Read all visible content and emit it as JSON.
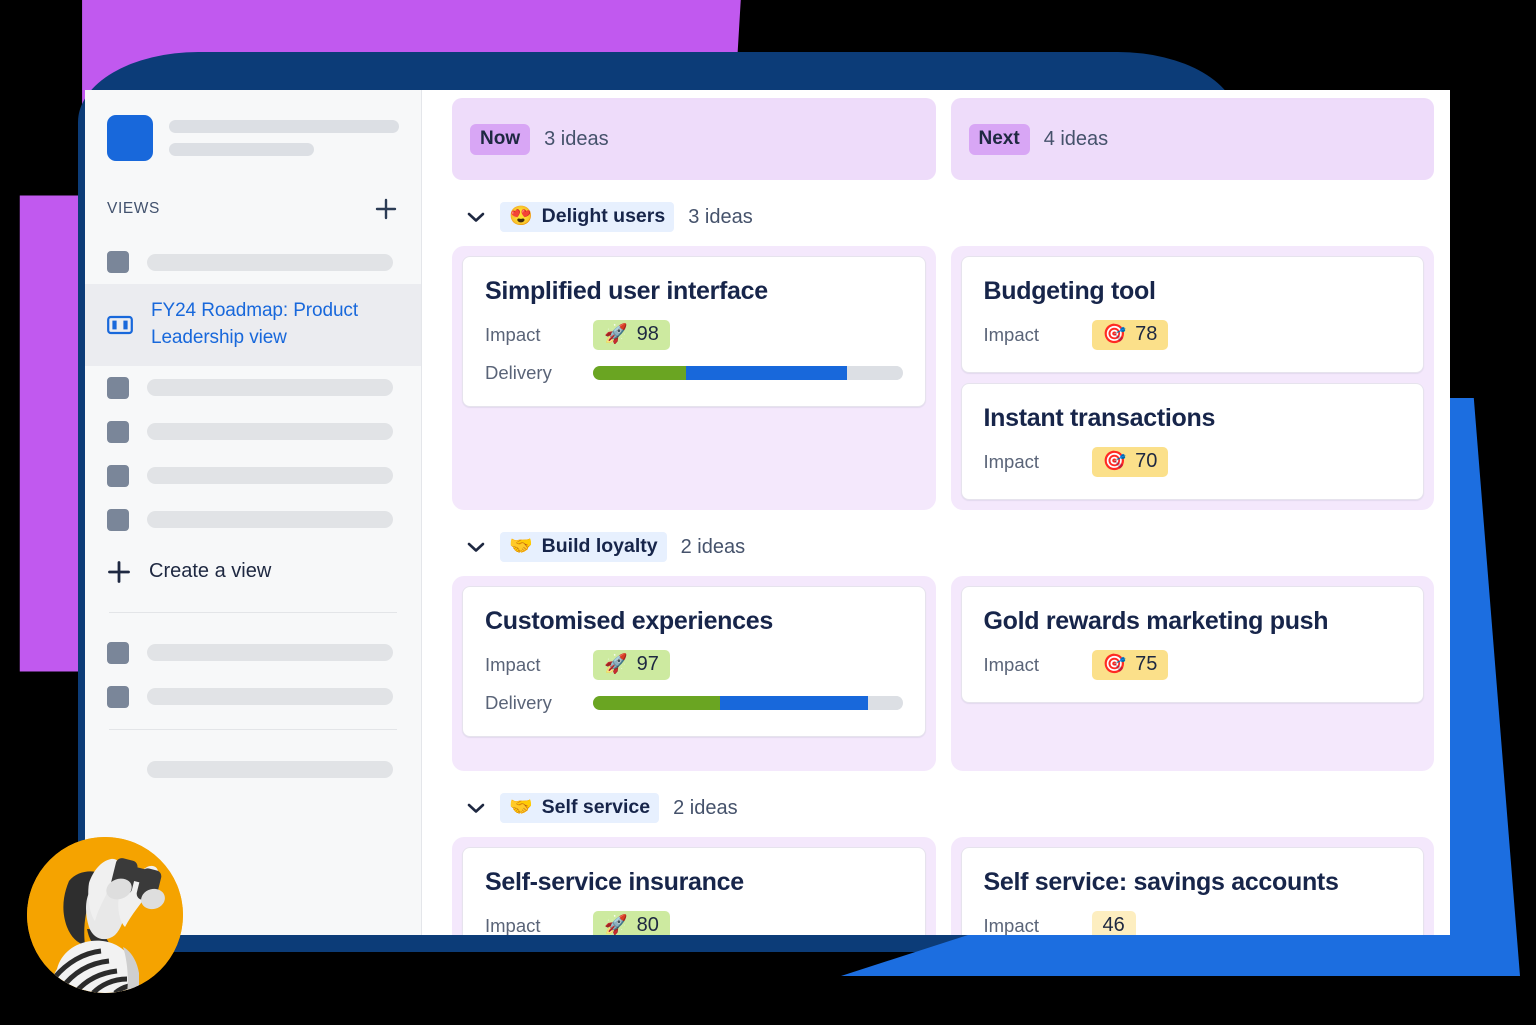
{
  "window": {
    "sidebar": {
      "views_heading": "VIEWS",
      "add_view_icon": "plus-icon",
      "active_view_label": "FY24 Roadmap: Product Leadership view",
      "active_view_icon": "board-columns-icon",
      "create_view_label": "Create a view",
      "create_view_icon": "plus-icon",
      "placeholder_items_top": 1,
      "placeholder_items_middle": 4,
      "placeholder_items_bottom": 2,
      "placeholder_items_footer": 1
    },
    "avatar": {
      "icon": "person-with-binoculars-photo",
      "background_color": "#f5a300"
    }
  },
  "board": {
    "columns": [
      {
        "pill": "Now",
        "count": "3 ideas"
      },
      {
        "pill": "Next",
        "count": "4 ideas"
      }
    ],
    "groups": [
      {
        "emoji": "😍",
        "emoji_name": "smiling-face-with-hearts-icon",
        "label": "Delight users",
        "count": "3 ideas",
        "chevron": "chevron-down-icon",
        "now_cards": [
          {
            "title": "Simplified user interface",
            "impact_label": "Impact",
            "impact_value": "98",
            "impact_emoji": "🚀",
            "impact_emoji_name": "rocket-icon",
            "impact_style": "green",
            "delivery_label": "Delivery",
            "delivery_segments": [
              {
                "color": "#6aa522",
                "percent": 30
              },
              {
                "color": "#1868db",
                "percent": 52
              },
              {
                "color": "#dcdfe4",
                "percent": 18
              }
            ]
          }
        ],
        "next_cards": [
          {
            "title": "Budgeting tool",
            "impact_label": "Impact",
            "impact_value": "78",
            "impact_emoji": "🎯",
            "impact_emoji_name": "target-icon",
            "impact_style": "yellow"
          },
          {
            "title": "Instant transactions",
            "impact_label": "Impact",
            "impact_value": "70",
            "impact_emoji": "🎯",
            "impact_emoji_name": "target-icon",
            "impact_style": "yellow"
          }
        ]
      },
      {
        "emoji": "🤝",
        "emoji_name": "handshake-icon",
        "label": "Build loyalty",
        "count": "2 ideas",
        "chevron": "chevron-down-icon",
        "now_cards": [
          {
            "title": "Customised experiences",
            "impact_label": "Impact",
            "impact_value": "97",
            "impact_emoji": "🚀",
            "impact_emoji_name": "rocket-icon",
            "impact_style": "green",
            "delivery_label": "Delivery",
            "delivery_segments": [
              {
                "color": "#6aa522",
                "percent": 41
              },
              {
                "color": "#1868db",
                "percent": 48
              },
              {
                "color": "#dcdfe4",
                "percent": 11
              }
            ]
          }
        ],
        "next_cards": [
          {
            "title": "Gold rewards marketing push",
            "impact_label": "Impact",
            "impact_value": "75",
            "impact_emoji": "🎯",
            "impact_emoji_name": "target-icon",
            "impact_style": "yellow"
          }
        ]
      },
      {
        "emoji": "🤝",
        "emoji_name": "handshake-icon",
        "label": "Self service",
        "count": "2 ideas",
        "chevron": "chevron-down-icon",
        "now_cards": [
          {
            "title": "Self-service insurance",
            "impact_label": "Impact",
            "impact_value": "80",
            "impact_emoji": "🚀",
            "impact_emoji_name": "rocket-icon",
            "impact_style": "green"
          }
        ],
        "next_cards": [
          {
            "title": "Self service: savings accounts",
            "impact_label": "Impact",
            "impact_value": "46",
            "impact_emoji": "",
            "impact_emoji_name": "none",
            "impact_style": "yellow-pale"
          }
        ]
      }
    ]
  },
  "colors": {
    "brand_blue": "#1868db",
    "deco_purple": "#c159ef",
    "deco_navy": "#0c3c78",
    "deco_blue": "#1c6ee0",
    "lane_purple": "#f4e8fc",
    "column_header_purple": "#eedcfa",
    "pill_purple": "#d8a6f5",
    "badge_green": "#cdeaa0",
    "badge_yellow": "#fbe08a",
    "avatar_orange": "#f5a300"
  }
}
